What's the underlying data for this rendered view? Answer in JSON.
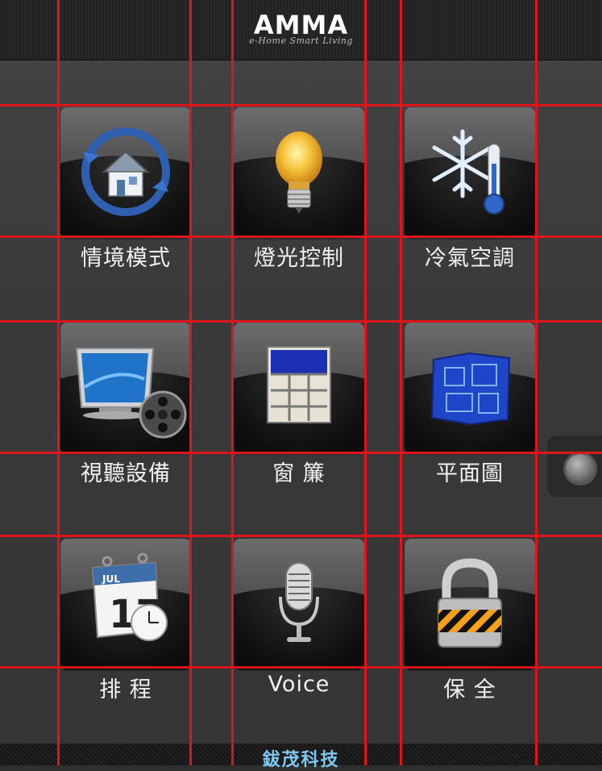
{
  "header": {
    "logo": "AMMA",
    "tagline": "e-Home Smart Living"
  },
  "tiles": [
    {
      "label": "情境模式",
      "icon": "home-refresh-icon"
    },
    {
      "label": "燈光控制",
      "icon": "light-bulb-icon"
    },
    {
      "label": "冷氣空調",
      "icon": "snowflake-thermometer-icon"
    },
    {
      "label": "視聽設備",
      "icon": "tv-film-reel-icon"
    },
    {
      "label": "窗 簾",
      "icon": "window-curtain-icon"
    },
    {
      "label": "平面圖",
      "icon": "floor-plan-icon"
    },
    {
      "label": "排 程",
      "icon": "calendar-clock-icon"
    },
    {
      "label": "Voice",
      "icon": "microphone-icon"
    },
    {
      "label": "保 全",
      "icon": "padlock-icon"
    }
  ],
  "calendar": {
    "month": "JUL",
    "day": "17"
  },
  "footer": {
    "text": "鈸茂科技"
  },
  "colors": {
    "gridline": "#e0151b",
    "label": "#f2f2f2",
    "footer_text": "#7cc8f0"
  }
}
